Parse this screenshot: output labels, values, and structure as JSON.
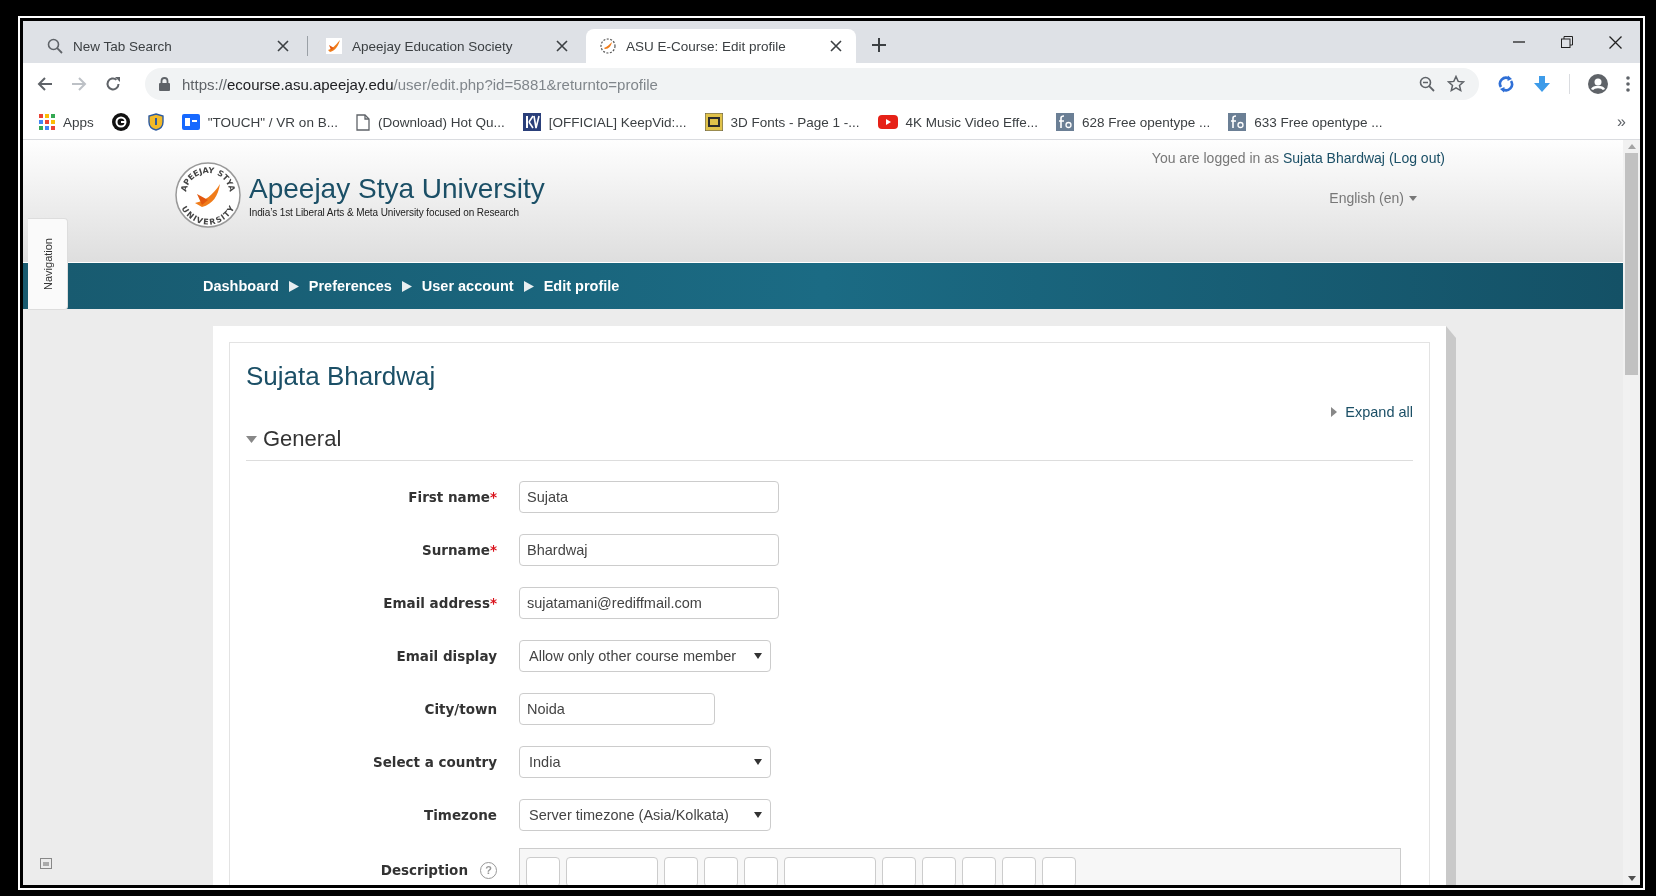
{
  "browser": {
    "tabs": [
      {
        "title": "New Tab Search",
        "kind": "search",
        "selected": false
      },
      {
        "title": "Apeejay Education Society",
        "kind": "bird",
        "selected": false
      },
      {
        "title": "ASU E-Course: Edit profile",
        "kind": "emblem",
        "selected": true
      }
    ],
    "url": {
      "scheme": "https://",
      "host": "ecourse.asu.apeejay.edu",
      "path": "/user/edit.php?id=5881&returnto=profile"
    },
    "bookmarks": [
      {
        "kind": "apps",
        "label": "Apps"
      },
      {
        "kind": "dark-circle"
      },
      {
        "kind": "shield"
      },
      {
        "kind": "behance",
        "label": "\"TOUCH\" / VR on B..."
      },
      {
        "kind": "page",
        "label": "(Download) Hot Qu..."
      },
      {
        "kind": "kv",
        "label": "[OFFICIAL] KeepVid:..."
      },
      {
        "kind": "fonts-3d",
        "label": "3D Fonts - Page 1 -..."
      },
      {
        "kind": "video",
        "label": "4K Music Video Effe..."
      },
      {
        "kind": "fs",
        "label": "628 Free opentype ..."
      },
      {
        "kind": "fs",
        "label": "633 Free opentype ..."
      }
    ],
    "bookmarks_overflow": "»"
  },
  "site": {
    "logo_ring": [
      "APEEJAY STYA",
      "UNIVERSITY"
    ],
    "title": "Apeejay Stya University",
    "tagline": "India’s 1st Liberal Arts & Meta University focused on Research",
    "login": {
      "prefix": "You are logged in as",
      "user": "Sujata Bhardwaj",
      "logout": "(Log out)"
    },
    "language": "English (en)",
    "navigation_tab": "Navigation"
  },
  "breadcrumb": [
    "Dashboard",
    "Preferences",
    "User account",
    "Edit profile"
  ],
  "profile": {
    "heading": "Sujata Bhardwaj",
    "expand_all": "Expand all",
    "section": {
      "title": "General",
      "expanded": true
    },
    "fields": [
      {
        "label": "First name",
        "required_mark": "*",
        "kind": "text",
        "value": "Sujata"
      },
      {
        "label": "Surname",
        "required_mark": "*",
        "kind": "text",
        "value": "Bhardwaj"
      },
      {
        "label": "Email address",
        "required_mark": "*",
        "kind": "text",
        "value": "sujatamani@rediffmail.com"
      },
      {
        "label": "Email display",
        "kind": "select",
        "value": "Allow only other course member"
      },
      {
        "label": "City/town",
        "kind": "short-text",
        "value": "Noida"
      },
      {
        "label": "Select a country",
        "kind": "select",
        "value": "India"
      },
      {
        "label": "Timezone",
        "kind": "select",
        "value": "Server timezone (Asia/Kolkata)"
      },
      {
        "label": "Description",
        "kind": "editor",
        "help": "?"
      }
    ]
  }
}
